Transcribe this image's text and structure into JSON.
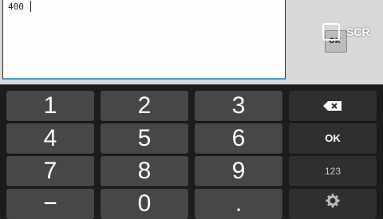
{
  "input": {
    "value": "400"
  },
  "overlay": {
    "label": "SCR",
    "icon_text": "OK"
  },
  "keypad": {
    "keys": [
      {
        "label": "1"
      },
      {
        "label": "2"
      },
      {
        "label": "3"
      },
      {
        "label": "4"
      },
      {
        "label": "5"
      },
      {
        "label": "6"
      },
      {
        "label": "7"
      },
      {
        "label": "8"
      },
      {
        "label": "9"
      },
      {
        "label": "−"
      },
      {
        "label": "0"
      },
      {
        "label": "."
      }
    ],
    "func": {
      "backspace_icon": "backspace-icon",
      "ok": "OK",
      "mode": "123",
      "settings_icon": "gear-icon"
    }
  }
}
